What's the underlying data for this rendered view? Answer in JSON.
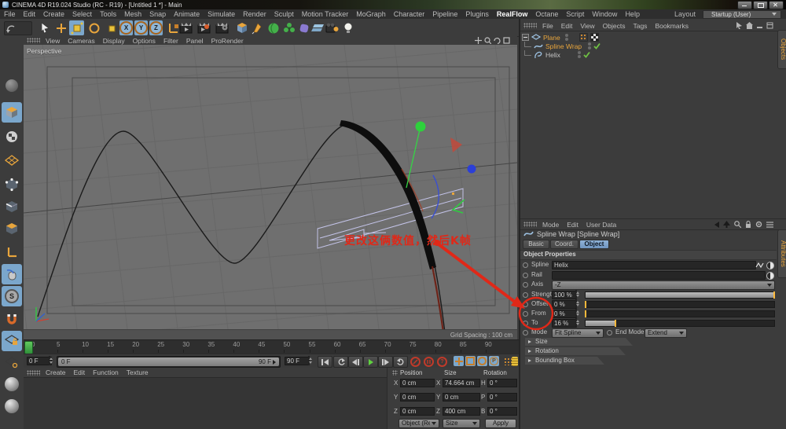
{
  "window": {
    "title": "CINEMA 4D R19.024 Studio (RC - R19) - [Untitled 1 *] - Main",
    "layout_label": "Layout",
    "layout_value": "Startup (User)"
  },
  "menu_bar": [
    "File",
    "Edit",
    "Create",
    "Select",
    "Tools",
    "Mesh",
    "Snap",
    "Animate",
    "Simulate",
    "Render",
    "Sculpt",
    "Motion Tracker",
    "MoGraph",
    "Character",
    "Pipeline",
    "Plugins",
    "RealFlow",
    "Octane",
    "Script",
    "Window",
    "Help"
  ],
  "toolbar": {
    "axis_x": "X",
    "axis_y": "Y",
    "axis_z": "Z"
  },
  "left_palette": {
    "snap_letter": "S"
  },
  "icons": {
    "question": "?",
    "param": "P"
  },
  "viewport": {
    "menu": [
      "View",
      "Cameras",
      "Display",
      "Options",
      "Filter",
      "Panel",
      "ProRender"
    ],
    "camera_label": "Perspective",
    "status": "Grid Spacing : 100 cm",
    "annotation": "更改这俩数值，然后K帧"
  },
  "object_manager": {
    "menu": [
      "File",
      "Edit",
      "View",
      "Objects",
      "Tags",
      "Bookmarks"
    ],
    "objects": [
      {
        "name": "Plane"
      },
      {
        "name": "Spline Wrap"
      },
      {
        "name": "Helix"
      }
    ],
    "side_tab": "Objects"
  },
  "attribute_manager": {
    "menu": [
      "Mode",
      "Edit",
      "User Data"
    ],
    "title": "Spline Wrap [Spline Wrap]",
    "tabs": [
      "Basic",
      "Coord.",
      "Object"
    ],
    "active_tab": "Object",
    "section_header": "Object Properties",
    "fields": {
      "spline": {
        "label": "Spline",
        "value": "Helix"
      },
      "rail": {
        "label": "Rail",
        "value": ""
      },
      "axis": {
        "label": "Axis",
        "value": "-Z"
      },
      "strength": {
        "label": "Strength",
        "value": "100 %",
        "percent": 100
      },
      "offset": {
        "label": "Offset",
        "value": "0 %",
        "percent": 0
      },
      "from": {
        "label": "From",
        "value": "0 %",
        "percent": 0
      },
      "to": {
        "label": "To",
        "value": "16 %",
        "percent": 16
      },
      "mode": {
        "label": "Mode",
        "value": "Fit Spline"
      },
      "end_mode": {
        "label": "End Mode",
        "value": "Extend"
      }
    },
    "collapsed_sections": [
      "Size",
      "Rotation",
      "Bounding Box"
    ],
    "side_tab": "Attributes"
  },
  "timeline": {
    "ticks": [
      "0",
      "5",
      "10",
      "15",
      "20",
      "25",
      "30",
      "35",
      "40",
      "45",
      "50",
      "55",
      "60",
      "65",
      "70",
      "75",
      "80",
      "85",
      "90"
    ],
    "current_frame": "0 F",
    "range_start": "0 F",
    "range_end": "90 F",
    "end_frame": "90 F"
  },
  "material_manager": {
    "menu": [
      "Create",
      "Edit",
      "Function",
      "Texture"
    ]
  },
  "coordinates": {
    "groups": [
      "Position",
      "Size",
      "Rotation"
    ],
    "position": {
      "x_label": "X",
      "x": "0 cm",
      "y_label": "Y",
      "y": "0 cm",
      "z_label": "Z",
      "z": "0 cm"
    },
    "size": {
      "x_label": "X",
      "x": "74.664 cm",
      "y_label": "Y",
      "y": "0 cm",
      "z_label": "Z",
      "z": "400 cm"
    },
    "rotation": {
      "h_label": "H",
      "h": "0 °",
      "p_label": "P",
      "p": "0 °",
      "b_label": "B",
      "b": "0 °"
    },
    "transform_mode": "Object (Rel",
    "value_mode": "Size",
    "apply_label": "Apply"
  },
  "colors": {
    "accent_orange": "#e8a53c",
    "selection_blue": "#7ba7cc",
    "annotation_red": "#e02818",
    "play_green": "#5fbf3f",
    "viewport_gray": "#6f6f6f"
  }
}
